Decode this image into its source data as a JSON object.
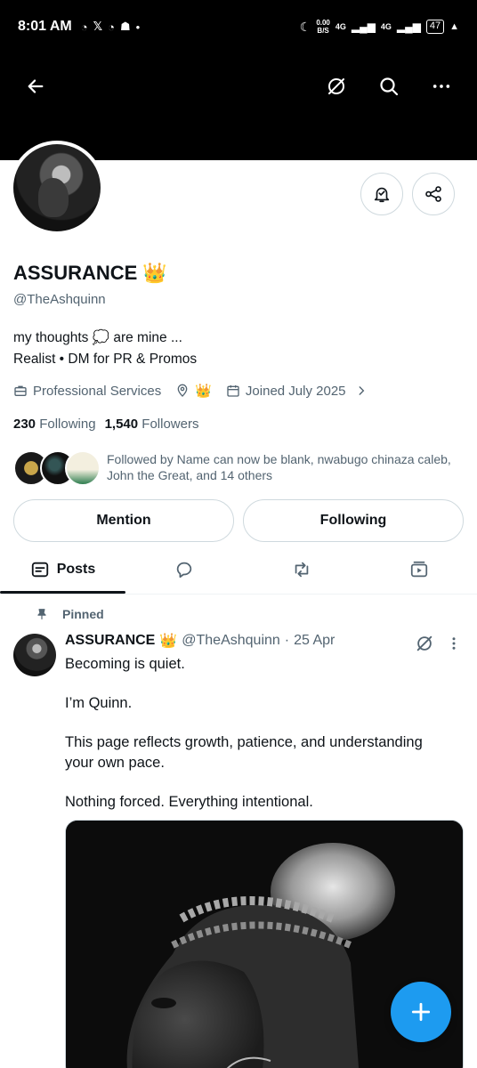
{
  "status_bar": {
    "time": "8:01 AM",
    "net_speed": "0.00",
    "net_unit": "B/S",
    "network_1": "4G",
    "network_2": "4G",
    "battery": "47"
  },
  "profile": {
    "name": "ASSURANCE",
    "name_emoji": "👑",
    "handle": "@TheAshquinn",
    "bio_line1": "my thoughts 💭 are mine ...",
    "bio_line2": "Realist • DM for PR & Promos",
    "category": "Professional Services",
    "location": "👑",
    "joined": "Joined July 2025",
    "following_count": "230",
    "following_label": "Following",
    "followers_count": "1,540",
    "followers_label": "Followers",
    "followed_by": "Followed by Name can now be blank, nwabugo chinaza caleb, John the Great, and 14 others"
  },
  "actions": {
    "mention_label": "Mention",
    "following_label": "Following"
  },
  "tabs": {
    "posts_label": "Posts"
  },
  "post": {
    "pinned_label": "Pinned",
    "author_name": "ASSURANCE",
    "author_emoji": "👑",
    "author_handle": "@TheAshquinn",
    "separator": "·",
    "date": "25 Apr",
    "lines": [
      "Becoming is quiet.",
      "I’m Quinn.",
      "This page reflects growth, patience, and understanding",
      "your own pace.",
      "Nothing forced. Everything intentional."
    ]
  },
  "colors": {
    "accent": "#1d9bf0",
    "muted": "#536471",
    "text": "#0f1419",
    "border": "#cfd9de"
  },
  "icons": [
    "back-arrow-icon",
    "grok-icon",
    "search-icon",
    "more-icon",
    "notification-bell-icon",
    "share-icon",
    "briefcase-icon",
    "location-pin-icon",
    "calendar-icon",
    "chevron-right-icon",
    "posts-icon",
    "replies-icon",
    "repost-icon",
    "media-icon",
    "pin-icon",
    "compose-plus-icon"
  ]
}
